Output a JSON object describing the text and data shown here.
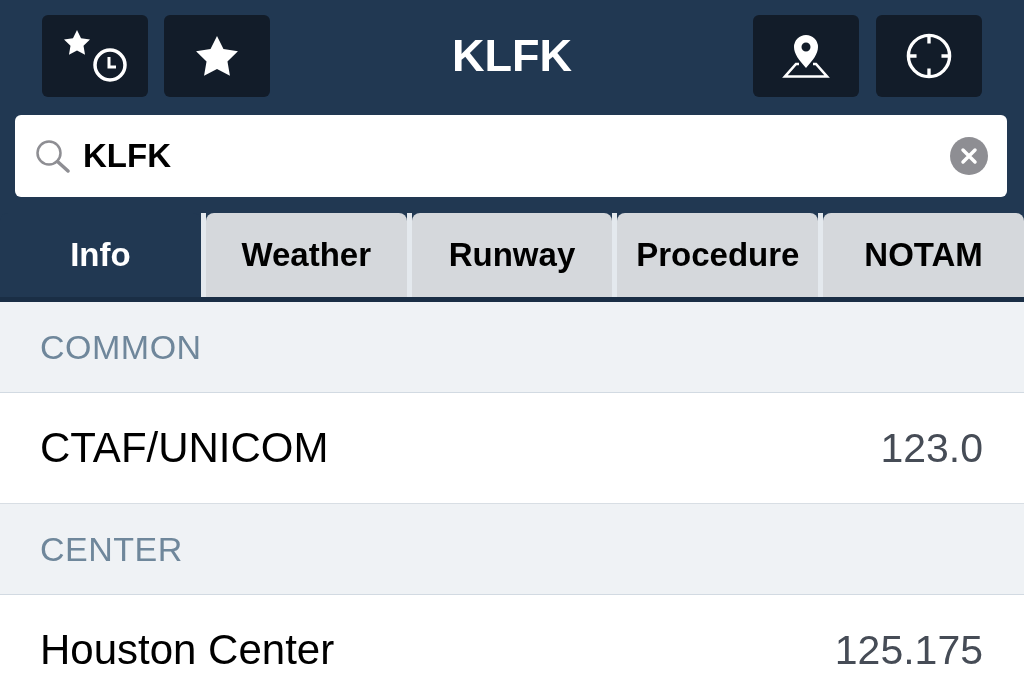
{
  "header": {
    "title": "KLFK"
  },
  "search": {
    "value": "KLFK"
  },
  "tabs": [
    {
      "label": "Info",
      "selected": true
    },
    {
      "label": "Weather",
      "selected": false
    },
    {
      "label": "Runway",
      "selected": false
    },
    {
      "label": "Procedure",
      "selected": false
    },
    {
      "label": "NOTAM",
      "selected": false
    }
  ],
  "sections": [
    {
      "title": "COMMON",
      "rows": [
        {
          "name": "CTAF/UNICOM",
          "frequency": "123.0"
        }
      ]
    },
    {
      "title": "CENTER",
      "rows": [
        {
          "name": "Houston Center",
          "frequency": "125.175"
        }
      ]
    }
  ]
}
